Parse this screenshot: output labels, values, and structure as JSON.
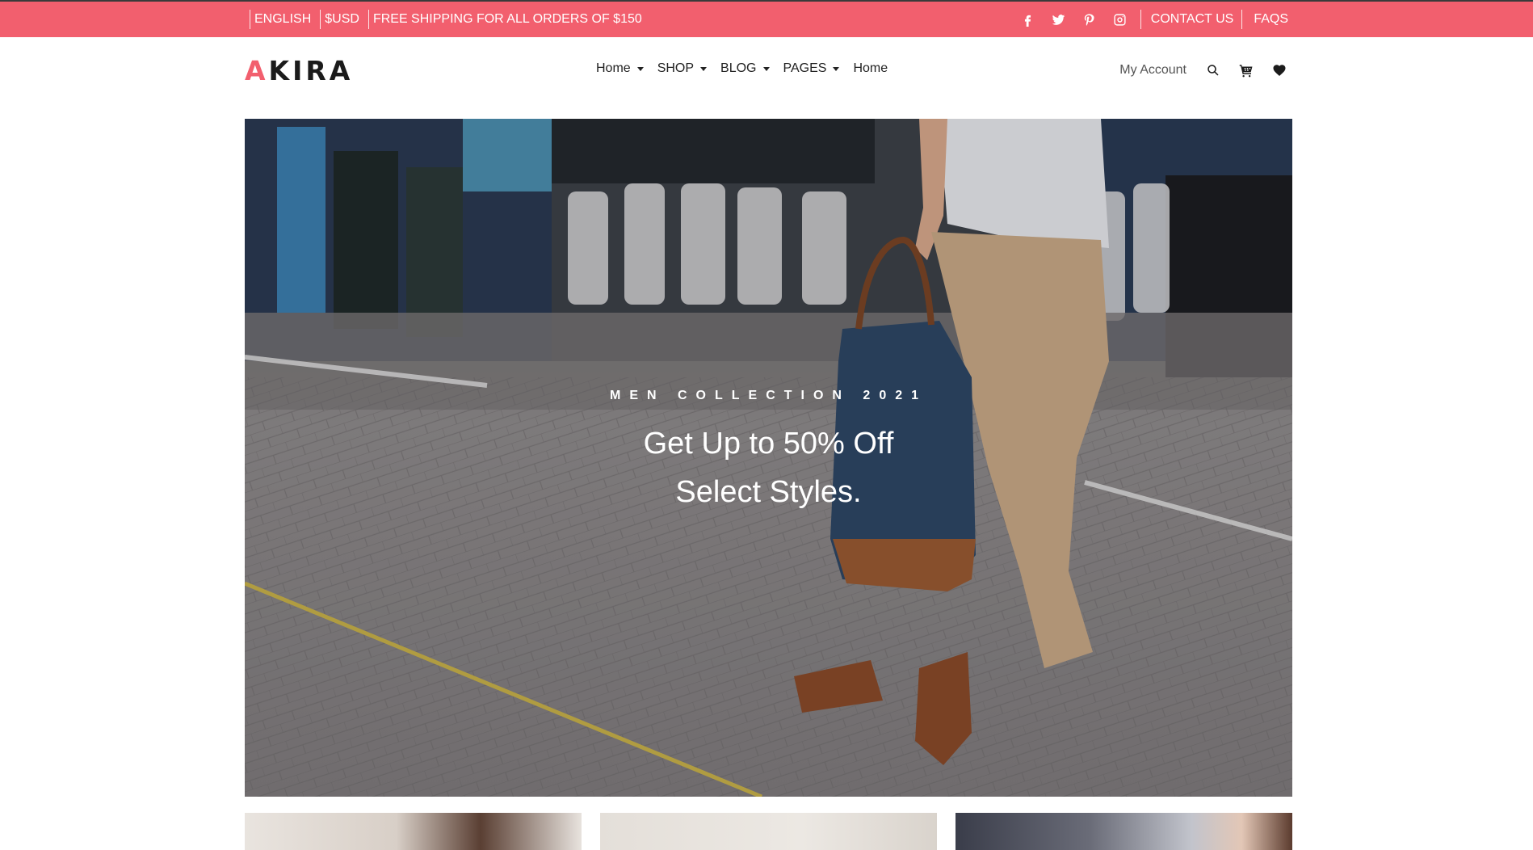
{
  "colors": {
    "accent": "#f25f6e",
    "text_dark": "#222222",
    "white": "#ffffff"
  },
  "topbar": {
    "language": "ENGLISH",
    "currency": "$USD",
    "shipping_notice": "FREE SHIPPING FOR ALL ORDERS OF $150",
    "social_icons": [
      "facebook-icon",
      "twitter-icon",
      "pinterest-icon",
      "instagram-icon"
    ],
    "contact_label": "CONTACT US",
    "faqs_label": "FAQS"
  },
  "header": {
    "logo_first_letter": "A",
    "logo_rest": "KIRA",
    "nav": [
      {
        "label": "Home",
        "dropdown": true
      },
      {
        "label": "SHOP",
        "dropdown": true
      },
      {
        "label": "BLOG",
        "dropdown": true
      },
      {
        "label": "PAGES",
        "dropdown": true
      },
      {
        "label": "Home",
        "dropdown": false
      }
    ],
    "account_label": "My Account",
    "icons": [
      "search-icon",
      "cart-icon",
      "heart-icon"
    ]
  },
  "hero": {
    "subtitle": "MEN COLLECTION 2021",
    "title_line1": "Get Up to 50% Off",
    "title_line2": "Select Styles."
  }
}
